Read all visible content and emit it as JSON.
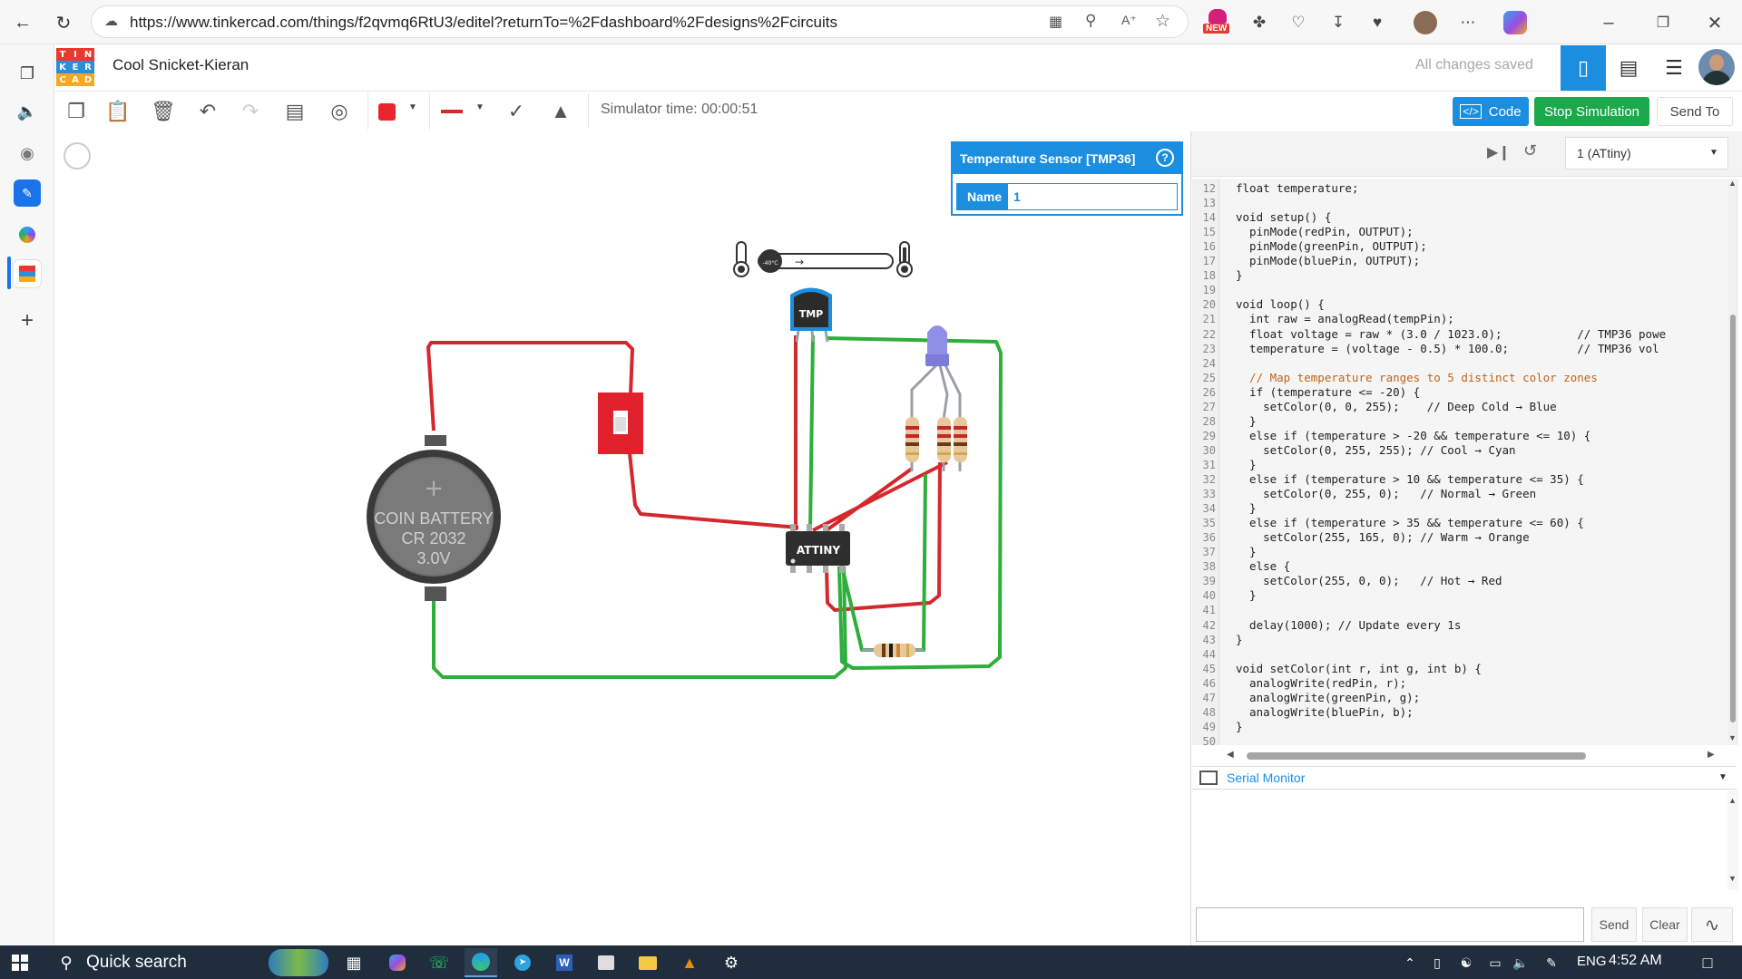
{
  "browser": {
    "url": "https://www.tinkercad.com/things/f2qvmq6RtU3/editel?returnTo=%2Fdashboard%2Fdesigns%2Fcircuits",
    "new_badge": "NEW"
  },
  "header": {
    "logo_letters": [
      "T",
      "I",
      "N",
      "K",
      "E",
      "R",
      "C",
      "A",
      "D"
    ],
    "logo_colors": [
      "#e8392f",
      "#e8392f",
      "#e8392f",
      "#2b8fd6",
      "#2b8fd6",
      "#2b8fd6",
      "#f7a823",
      "#f7a823",
      "#f7a823"
    ],
    "project_title": "Cool Snicket-Kieran",
    "save_status": "All changes saved"
  },
  "toolbar": {
    "sim_time": "Simulator time: 00:00:51",
    "code_label": "Code",
    "stop_label": "Stop Simulation",
    "send_label": "Send To",
    "fill_color": "#e8262b",
    "line_color": "#d6282d"
  },
  "properties": {
    "title": "Temperature Sensor [TMP36]",
    "help": "?",
    "name_label": "Name",
    "name_value": "1"
  },
  "circuit": {
    "battery_lines": [
      "COIN BATTERY",
      "CR 2032",
      "3.0V"
    ],
    "battery_plus": "+",
    "sensor_label": "TMP",
    "chip_label": "ATTINY",
    "slider_label": "-40°C"
  },
  "code_panel": {
    "device": "1 (ATtiny)",
    "lines": [
      {
        "n": "12",
        "t": "float temperature;"
      },
      {
        "n": "13",
        "t": ""
      },
      {
        "n": "14",
        "t": "void setup() {"
      },
      {
        "n": "15",
        "t": "  pinMode(redPin, OUTPUT);"
      },
      {
        "n": "16",
        "t": "  pinMode(greenPin, OUTPUT);"
      },
      {
        "n": "17",
        "t": "  pinMode(bluePin, OUTPUT);"
      },
      {
        "n": "18",
        "t": "}"
      },
      {
        "n": "19",
        "t": ""
      },
      {
        "n": "20",
        "t": "void loop() {"
      },
      {
        "n": "21",
        "t": "  int raw = analogRead(tempPin);"
      },
      {
        "n": "22",
        "t": "  float voltage = raw * (3.0 / 1023.0);           // TMP36 powe"
      },
      {
        "n": "23",
        "t": "  temperature = (voltage - 0.5) * 100.0;          // TMP36 vol"
      },
      {
        "n": "24",
        "t": ""
      },
      {
        "n": "25",
        "t": "  // Map temperature ranges to 5 distinct color zones"
      },
      {
        "n": "26",
        "t": "  if (temperature <= -20) {"
      },
      {
        "n": "27",
        "t": "    setColor(0, 0, 255);    // Deep Cold → Blue"
      },
      {
        "n": "28",
        "t": "  }"
      },
      {
        "n": "29",
        "t": "  else if (temperature > -20 && temperature <= 10) {"
      },
      {
        "n": "30",
        "t": "    setColor(0, 255, 255); // Cool → Cyan"
      },
      {
        "n": "31",
        "t": "  }"
      },
      {
        "n": "32",
        "t": "  else if (temperature > 10 && temperature <= 35) {"
      },
      {
        "n": "33",
        "t": "    setColor(0, 255, 0);   // Normal → Green"
      },
      {
        "n": "34",
        "t": "  }"
      },
      {
        "n": "35",
        "t": "  else if (temperature > 35 && temperature <= 60) {"
      },
      {
        "n": "36",
        "t": "    setColor(255, 165, 0); // Warm → Orange"
      },
      {
        "n": "37",
        "t": "  }"
      },
      {
        "n": "38",
        "t": "  else {"
      },
      {
        "n": "39",
        "t": "    setColor(255, 0, 0);   // Hot → Red"
      },
      {
        "n": "40",
        "t": "  }"
      },
      {
        "n": "41",
        "t": ""
      },
      {
        "n": "42",
        "t": "  delay(1000); // Update every 1s"
      },
      {
        "n": "43",
        "t": "}"
      },
      {
        "n": "44",
        "t": ""
      },
      {
        "n": "45",
        "t": "void setColor(int r, int g, int b) {"
      },
      {
        "n": "46",
        "t": "  analogWrite(redPin, r);"
      },
      {
        "n": "47",
        "t": "  analogWrite(greenPin, g);"
      },
      {
        "n": "48",
        "t": "  analogWrite(bluePin, b);"
      },
      {
        "n": "49",
        "t": "}"
      },
      {
        "n": "50",
        "t": ""
      }
    ],
    "serial_title": "Serial Monitor",
    "send_btn": "Send",
    "clear_btn": "Clear"
  },
  "taskbar": {
    "search": "Quick search",
    "lang": "ENG",
    "time": "4:52 AM"
  }
}
